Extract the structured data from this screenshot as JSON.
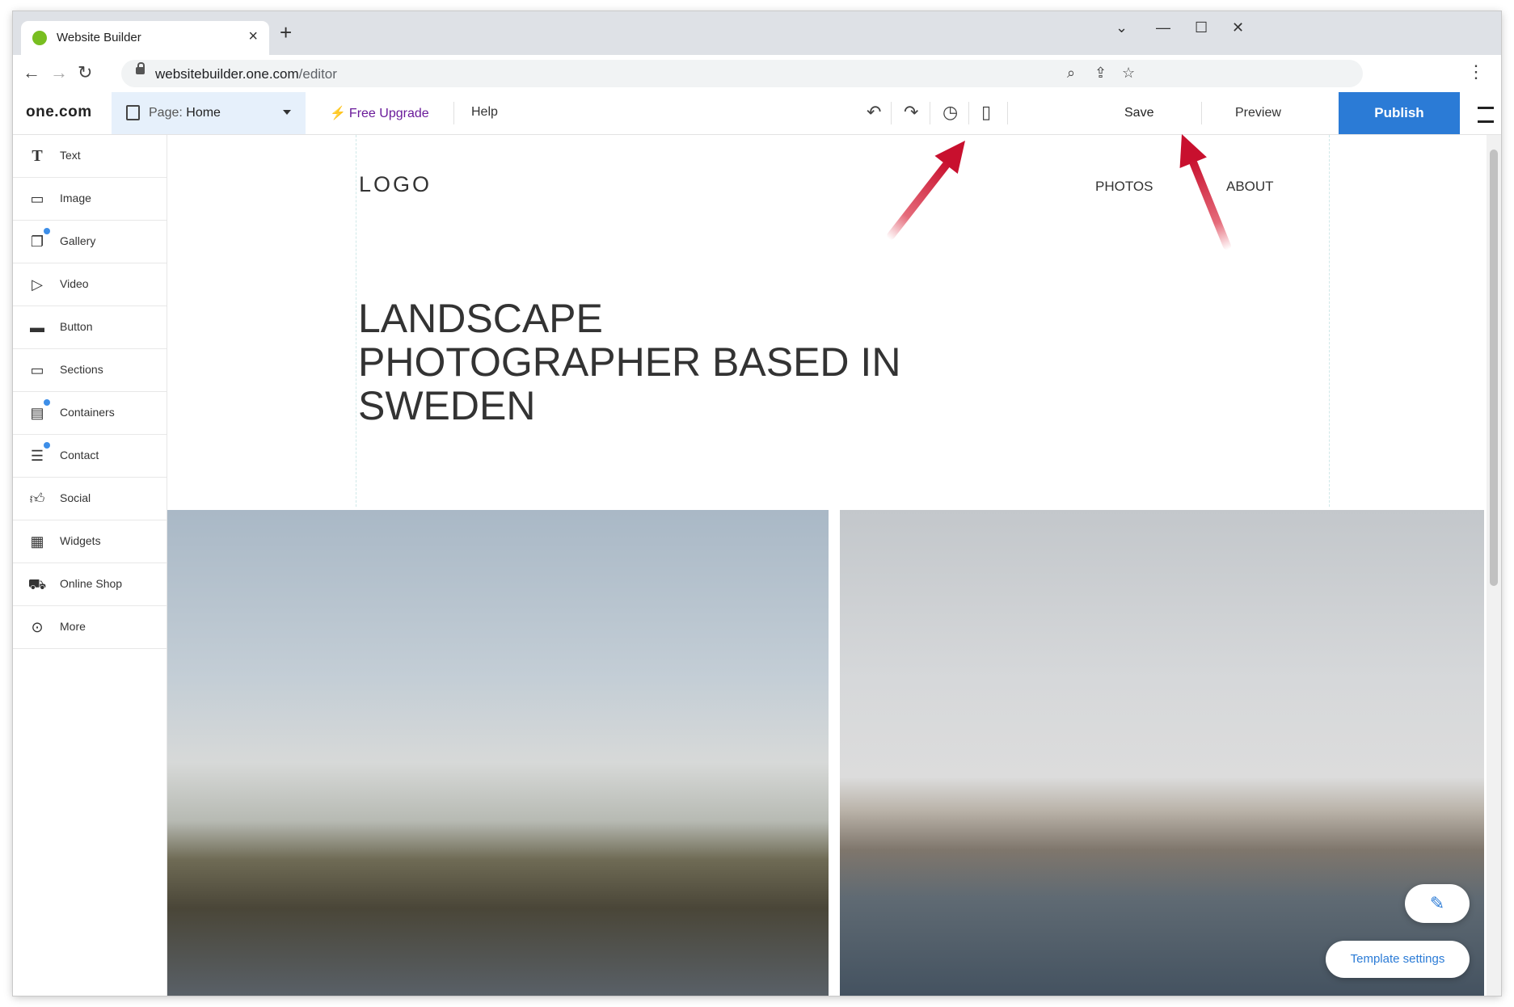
{
  "browser": {
    "tab_title": "Website Builder",
    "new_tab": "+",
    "url_host": "websitebuilder.one.com",
    "url_path": "/editor"
  },
  "toolbar": {
    "brand": "one.com",
    "page_prefix": "Page:",
    "page_value": "Home",
    "free_upgrade": "Free Upgrade",
    "help": "Help",
    "save": "Save",
    "preview": "Preview",
    "publish": "Publish",
    "publish_color": "#2b7bd6"
  },
  "sidebar": {
    "items": [
      {
        "label": "Text",
        "icon": "text-icon"
      },
      {
        "label": "Image",
        "icon": "image-icon"
      },
      {
        "label": "Gallery",
        "icon": "gallery-icon"
      },
      {
        "label": "Video",
        "icon": "video-icon"
      },
      {
        "label": "Button",
        "icon": "button-icon"
      },
      {
        "label": "Sections",
        "icon": "sections-icon"
      },
      {
        "label": "Containers",
        "icon": "containers-icon"
      },
      {
        "label": "Contact",
        "icon": "contact-icon"
      },
      {
        "label": "Social",
        "icon": "social-icon"
      },
      {
        "label": "Widgets",
        "icon": "widgets-icon"
      },
      {
        "label": "Online Shop",
        "icon": "cart-icon"
      },
      {
        "label": "More",
        "icon": "more-icon"
      }
    ]
  },
  "site": {
    "logo": "LOGO",
    "nav": [
      "PHOTOS",
      "ABOUT"
    ],
    "headline": "LANDSCAPE PHOTOGRAPHER BASED IN SWEDEN"
  },
  "canvas_controls": {
    "template_settings": "Template settings"
  }
}
